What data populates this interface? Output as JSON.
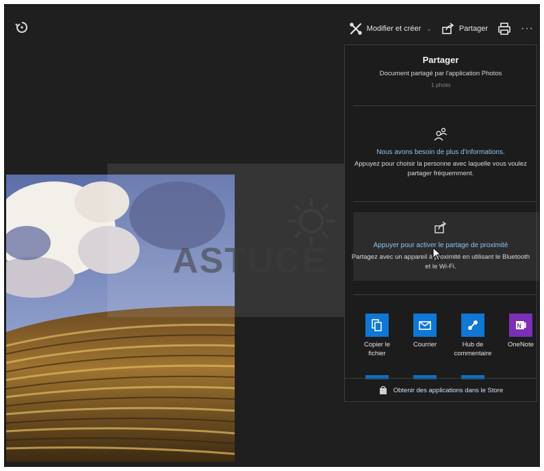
{
  "toolbar": {
    "edit_label": "Modifier et créer",
    "share_label": "Partager"
  },
  "watermark": "ASTUCE",
  "share_panel": {
    "title": "Partager",
    "subtitle": "Document partagé par l'application Photos",
    "count": "1 photo",
    "people": {
      "title": "Nous avons besoin de plus d'informations.",
      "description": "Appuyez pour choisir la personne avec laquelle vous voulez partager fréquemment."
    },
    "nearby": {
      "title": "Appuyer pour activer le partage de proximité",
      "description": "Partagez avec un appareil à proximité en utilisant le Bluetooth et le Wi-Fi."
    },
    "apps": [
      {
        "label": "Copier le fichier",
        "icon": "copy-file-icon",
        "color": "#0e78d4"
      },
      {
        "label": "Courrier",
        "icon": "mail-icon",
        "color": "#0e78d4"
      },
      {
        "label": "Hub de commentaire",
        "icon": "feedback-hub-icon",
        "color": "#0e78d4"
      },
      {
        "label": "OneNote",
        "icon": "onenote-icon",
        "color": "#7b2fb6"
      }
    ],
    "store_link": "Obtenir des applications dans le Store"
  }
}
